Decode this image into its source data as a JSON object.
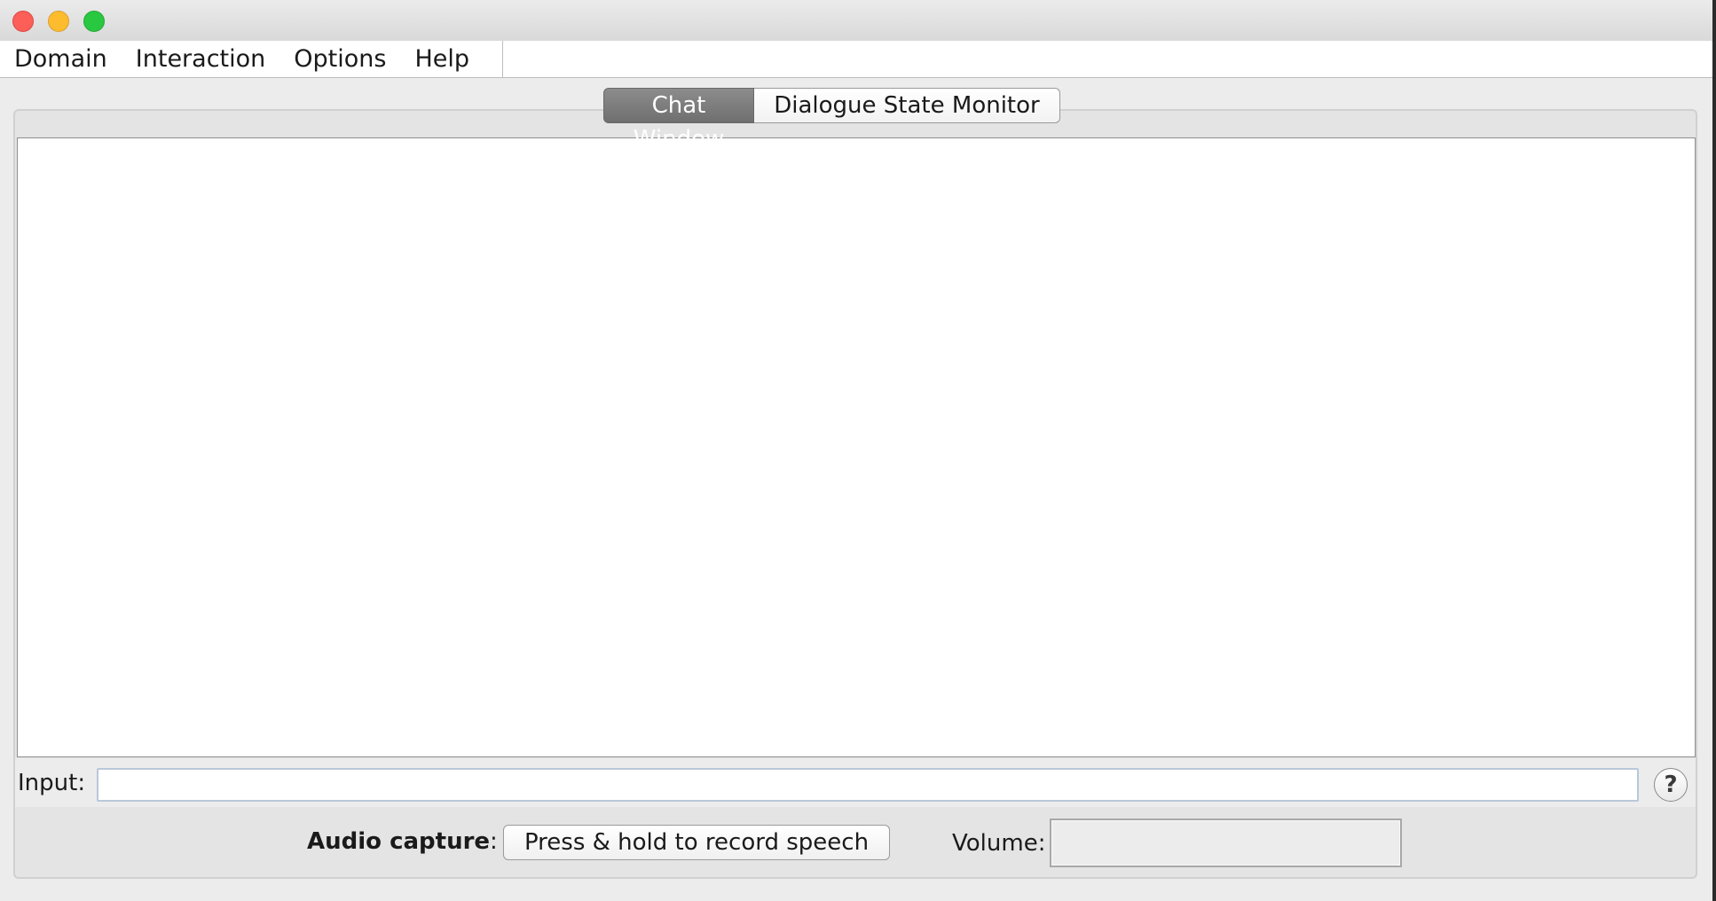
{
  "menu": {
    "items": [
      "Domain",
      "Interaction",
      "Options",
      "Help"
    ]
  },
  "tabs": {
    "chat_window": "Chat Window",
    "dialogue_state_monitor": "Dialogue State Monitor",
    "active": "Chat Window"
  },
  "input": {
    "label": "Input:",
    "value": "",
    "help_label": "?"
  },
  "audio": {
    "capture_label": "Audio capture",
    "capture_suffix": ":",
    "record_button_label": "Press & hold to record speech",
    "volume_label": "Volume:"
  },
  "colors": {
    "close": "#fc5f57",
    "minimize": "#fdbc2e",
    "maximize": "#28c840",
    "active_tab": "#7e7e7e"
  }
}
